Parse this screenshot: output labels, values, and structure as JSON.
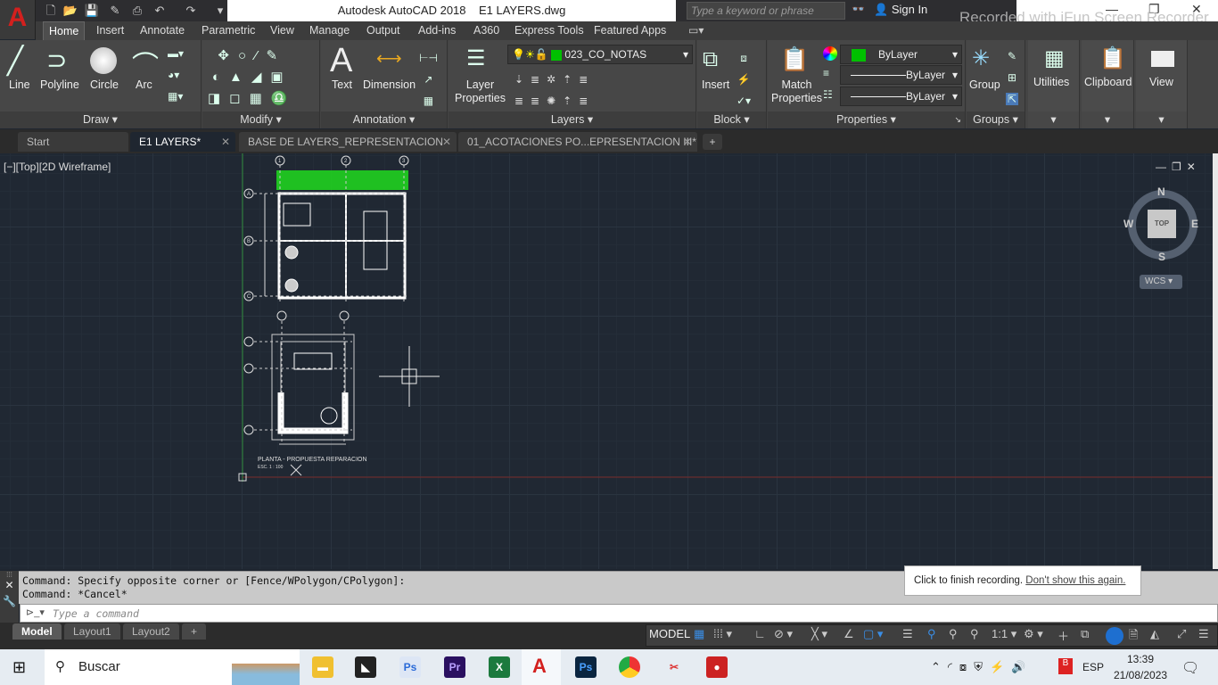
{
  "app": {
    "title": "Autodesk AutoCAD 2018",
    "file": "E1 LAYERS.dwg",
    "search_placeholder": "Type a keyword or phrase",
    "sign_in": "Sign In",
    "watermark": "Recorded with iFun Screen Recorder"
  },
  "ribbon_tabs": [
    "Home",
    "Insert",
    "Annotate",
    "Parametric",
    "View",
    "Manage",
    "Output",
    "Add-ins",
    "A360",
    "Express Tools",
    "Featured Apps"
  ],
  "panels": {
    "draw": {
      "label": "Draw",
      "tools": [
        "Line",
        "Polyline",
        "Circle",
        "Arc"
      ]
    },
    "modify": {
      "label": "Modify"
    },
    "annotation": {
      "label": "Annotation",
      "tools": [
        "Text",
        "Dimension"
      ]
    },
    "layers": {
      "label": "Layers",
      "tool": "Layer Properties",
      "current_layer": "023_CO_NOTAS",
      "layer_color": "#00c000"
    },
    "block": {
      "label": "Block",
      "tool": "Insert"
    },
    "properties": {
      "label": "Properties",
      "tool": "Match Properties",
      "color": "ByLayer",
      "linetype": "ByLayer",
      "lineweight": "ByLayer"
    },
    "groups": {
      "label": "Groups",
      "tool": "Group"
    },
    "utilities": {
      "label": "Utilities"
    },
    "clipboard": {
      "label": "Clipboard"
    },
    "view": {
      "label": "View"
    }
  },
  "file_tabs": [
    "Start",
    "E1 LAYERS*",
    "BASE DE LAYERS_REPRESENTACION III*",
    "01_ACOTACIONES PO...EPRESENTACION III*"
  ],
  "viewport": {
    "label": "[−][Top][2D Wireframe]",
    "compass": {
      "n": "N",
      "s": "S",
      "e": "E",
      "w": "W",
      "top": "TOP",
      "ucs": "WCS"
    }
  },
  "drawing": {
    "title": "PLANTA - PROPUESTA REPARACION",
    "scale": "ESC. 1 : 100",
    "grid_cols": [
      "1",
      "2",
      "3"
    ],
    "grid_rows": [
      "A",
      "B",
      "C"
    ]
  },
  "command": {
    "history": [
      "Command: Specify opposite corner or [Fence/WPolygon/CPolygon]:",
      "Command: *Cancel*"
    ],
    "placeholder": "Type a command"
  },
  "layout_tabs": [
    "Model",
    "Layout1",
    "Layout2",
    "+"
  ],
  "status": {
    "space": "MODEL",
    "scale": "1:1"
  },
  "toast": {
    "text": "Click to finish recording.",
    "link": "Don't show this again."
  },
  "taskbar": {
    "search": "Buscar",
    "lang": "ESP",
    "time": "13:39",
    "date": "21/08/2023"
  }
}
